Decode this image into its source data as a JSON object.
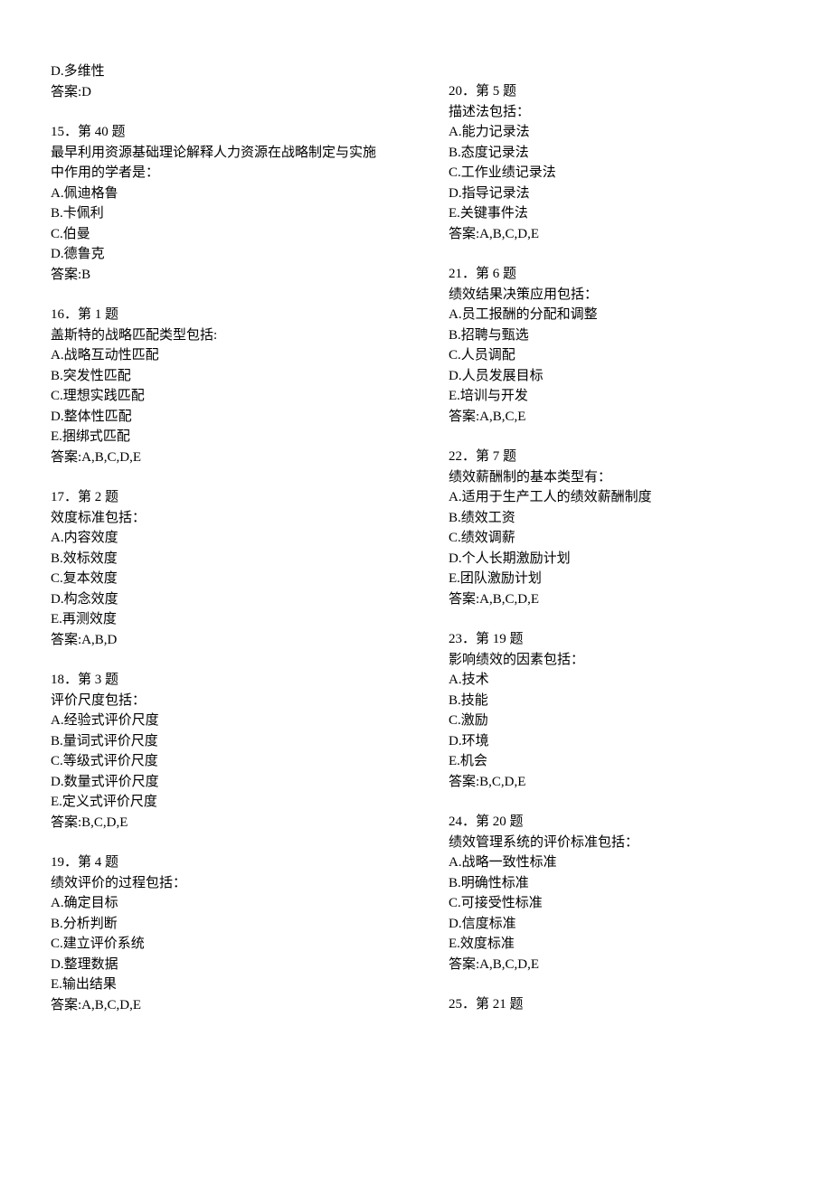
{
  "left": {
    "pre_d": "D.多维性",
    "pre_answer": "答案:D",
    "q15": {
      "heading": "15．第 40 题",
      "stem1": "最早利用资源基础理论解释人力资源在战略制定与实施",
      "stem2": "中作用的学者是：",
      "a": "A.佩迪格鲁",
      "b": "B.卡佩利",
      "c": "C.伯曼",
      "d": "D.德鲁克",
      "ans": "答案:B"
    },
    "q16": {
      "heading": "16．第 1 题",
      "stem": "盖斯特的战略匹配类型包括:",
      "a": "A.战略互动性匹配",
      "b": "B.突发性匹配",
      "c": "C.理想实践匹配",
      "d": "D.整体性匹配",
      "e": "E.捆绑式匹配",
      "ans": "答案:A,B,C,D,E"
    },
    "q17": {
      "heading": "17．第 2 题",
      "stem": "效度标准包括：",
      "a": "A.内容效度",
      "b": "B.效标效度",
      "c": "C.复本效度",
      "d": "D.构念效度",
      "e": "E.再测效度",
      "ans": "答案:A,B,D"
    },
    "q18": {
      "heading": "18．第 3 题",
      "stem": "评价尺度包括：",
      "a": "A.经验式评价尺度",
      "b": "B.量词式评价尺度",
      "c": "C.等级式评价尺度",
      "d": "D.数量式评价尺度",
      "e": "E.定义式评价尺度",
      "ans": "答案:B,C,D,E"
    },
    "q19": {
      "heading": "19．第 4 题",
      "stem": "绩效评价的过程包括：",
      "a": "A.确定目标",
      "b": "B.分析判断",
      "c": "C.建立评价系统",
      "d": "D.整理数据",
      "e": "E.输出结果",
      "ans": "答案:A,B,C,D,E"
    }
  },
  "right": {
    "q20": {
      "heading": "20．第 5 题",
      "stem": "描述法包括：",
      "a": "A.能力记录法",
      "b": "B.态度记录法",
      "c": "C.工作业绩记录法",
      "d": "D.指导记录法",
      "e": "E.关键事件法",
      "ans": "答案:A,B,C,D,E"
    },
    "q21": {
      "heading": "21．第 6 题",
      "stem": "绩效结果决策应用包括：",
      "a": "A.员工报酬的分配和调整",
      "b": "B.招聘与甄选",
      "c": "C.人员调配",
      "d": "D.人员发展目标",
      "e": "E.培训与开发",
      "ans": "答案:A,B,C,E"
    },
    "q22": {
      "heading": "22．第 7 题",
      "stem": "绩效薪酬制的基本类型有：",
      "a": "A.适用于生产工人的绩效薪酬制度",
      "b": "B.绩效工资",
      "c": "C.绩效调薪",
      "d": "D.个人长期激励计划",
      "e": "E.团队激励计划",
      "ans": "答案:A,B,C,D,E"
    },
    "q23": {
      "heading": "23．第 19 题",
      "stem": "影响绩效的因素包括：",
      "a": "A.技术",
      "b": "B.技能",
      "c": "C.激励",
      "d": "D.环境",
      "e": "E.机会",
      "ans": "答案:B,C,D,E"
    },
    "q24": {
      "heading": "24．第 20 题",
      "stem": "绩效管理系统的评价标准包括：",
      "a": "A.战略一致性标准",
      "b": "B.明确性标准",
      "c": "C.可接受性标准",
      "d": "D.信度标准",
      "e": "E.效度标准",
      "ans": "答案:A,B,C,D,E"
    },
    "q25": {
      "heading": "25．第 21 题"
    }
  }
}
